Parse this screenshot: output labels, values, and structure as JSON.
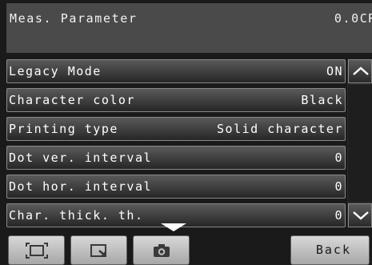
{
  "header": {
    "title": "Meas. Parameter",
    "value": "0.0CR"
  },
  "settings": [
    {
      "label": "Legacy Mode",
      "value": "ON"
    },
    {
      "label": "Character color",
      "value": "Black"
    },
    {
      "label": "Printing type",
      "value": "Solid character"
    },
    {
      "label": "Dot ver. interval",
      "value": "0"
    },
    {
      "label": "Dot hor. interval",
      "value": "0"
    },
    {
      "label": "Char. thick. th.",
      "value": "0"
    }
  ],
  "toolbar": {
    "back_label": "Back",
    "icons": [
      "fit-screen-icon",
      "zoom-select-icon",
      "camera-icon"
    ]
  }
}
